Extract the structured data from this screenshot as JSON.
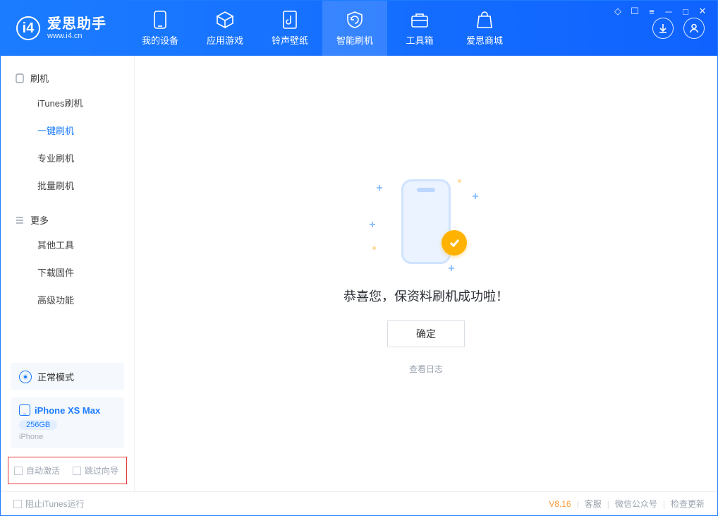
{
  "app": {
    "name": "爱思助手",
    "url": "www.i4.cn"
  },
  "tabs": {
    "device": "我的设备",
    "apps": "应用游戏",
    "ring": "铃声壁纸",
    "flash": "智能刷机",
    "toolbox": "工具箱",
    "store": "爱思商城"
  },
  "sidebar": {
    "section_flash": "刷机",
    "items_flash": {
      "itunes": "iTunes刷机",
      "oneclick": "一键刷机",
      "pro": "专业刷机",
      "batch": "批量刷机"
    },
    "section_more": "更多",
    "items_more": {
      "other": "其他工具",
      "firmware": "下载固件",
      "advanced": "高级功能"
    }
  },
  "mode": {
    "label": "正常模式"
  },
  "device": {
    "name": "iPhone XS Max",
    "capacity": "256GB",
    "type": "iPhone"
  },
  "checks": {
    "auto_activate": "自动激活",
    "skip_guide": "跳过向导"
  },
  "main": {
    "success": "恭喜您，保资料刷机成功啦！",
    "ok": "确定",
    "view_log": "查看日志"
  },
  "footer": {
    "block_itunes": "阻止iTunes运行",
    "version": "V8.16",
    "support": "客服",
    "wechat": "微信公众号",
    "update": "检查更新"
  }
}
